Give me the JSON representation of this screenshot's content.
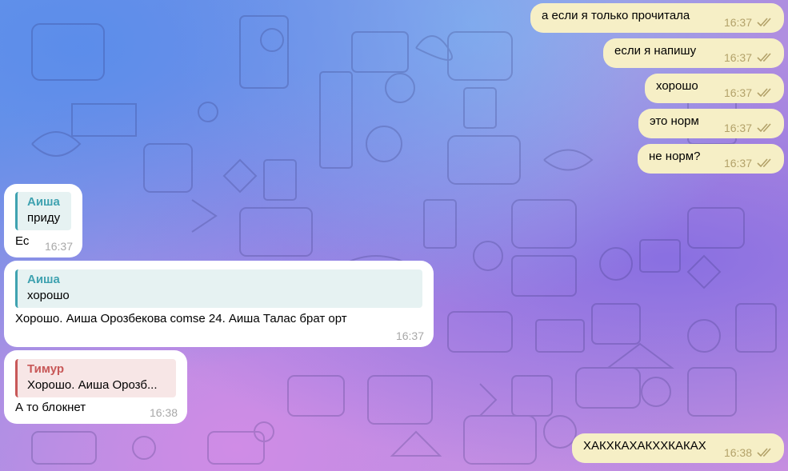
{
  "outgoing": [
    {
      "text": "а если я только прочитала",
      "time": "16:37"
    },
    {
      "text": "если я напишу",
      "time": "16:37"
    },
    {
      "text": "хорошо",
      "time": "16:37"
    },
    {
      "text": "это норм",
      "time": "16:37"
    },
    {
      "text": "не норм?",
      "time": "16:37"
    },
    {
      "text": "ХАКХКАХАКХХКАКАХ",
      "time": "16:38"
    }
  ],
  "incoming": [
    {
      "reply_name": "Аиша",
      "reply_text": "приду",
      "text": "Ес",
      "time": "16:37"
    },
    {
      "reply_name": "Аиша",
      "reply_text": "хорошо",
      "text": "Хорошо. Аиша Орозбекова comse 24. Аиша Талас брат орт",
      "time": "16:37"
    },
    {
      "reply_name": "Тимур",
      "reply_text": "Хорошо. Аиша Орозб...",
      "text": "А то блокнет",
      "time": "16:38"
    }
  ],
  "colors": {
    "outgoing_bubble": "#f6efc6",
    "incoming_bubble": "#ffffff",
    "reply_teal": "#3fa2b0",
    "reply_red": "#c85858"
  }
}
